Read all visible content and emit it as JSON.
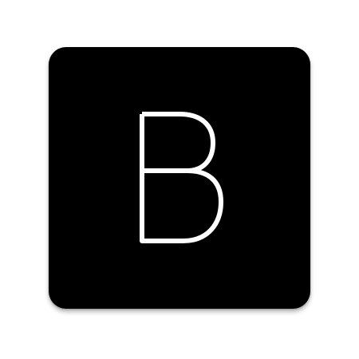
{
  "app_icon": {
    "icon": "letter-b-app-icon",
    "letter": "B",
    "background_color": "#000000",
    "letter_color": "#ffffff"
  }
}
